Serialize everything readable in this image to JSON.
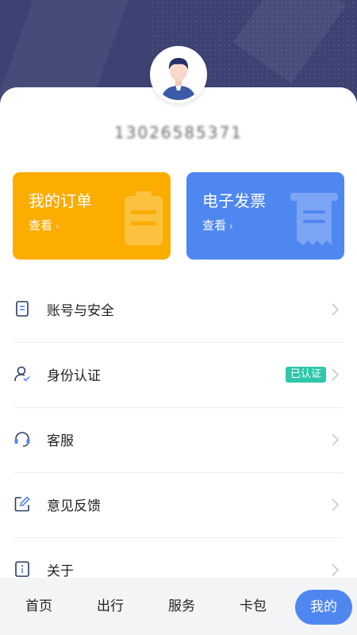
{
  "profile": {
    "phone": "13026585371"
  },
  "cards": {
    "orders": {
      "title": "我的订单",
      "link": "查看",
      "color": "#fdac00"
    },
    "invoice": {
      "title": "电子发票",
      "link": "查看",
      "color": "#4f87f0"
    }
  },
  "menu": [
    {
      "label": "账号与安全",
      "icon": "document-icon"
    },
    {
      "label": "身份认证",
      "icon": "user-check-icon",
      "badge": "已认证"
    },
    {
      "label": "客服",
      "icon": "headset-icon"
    },
    {
      "label": "意见反馈",
      "icon": "edit-icon"
    },
    {
      "label": "关于",
      "icon": "info-icon"
    }
  ],
  "tabs": [
    {
      "label": "首页"
    },
    {
      "label": "出行"
    },
    {
      "label": "服务"
    },
    {
      "label": "卡包"
    },
    {
      "label": "我的",
      "active": true
    }
  ],
  "colors": {
    "header": "#3c4373",
    "accent": "#4f87f0",
    "verified": "#2ec7a9"
  }
}
